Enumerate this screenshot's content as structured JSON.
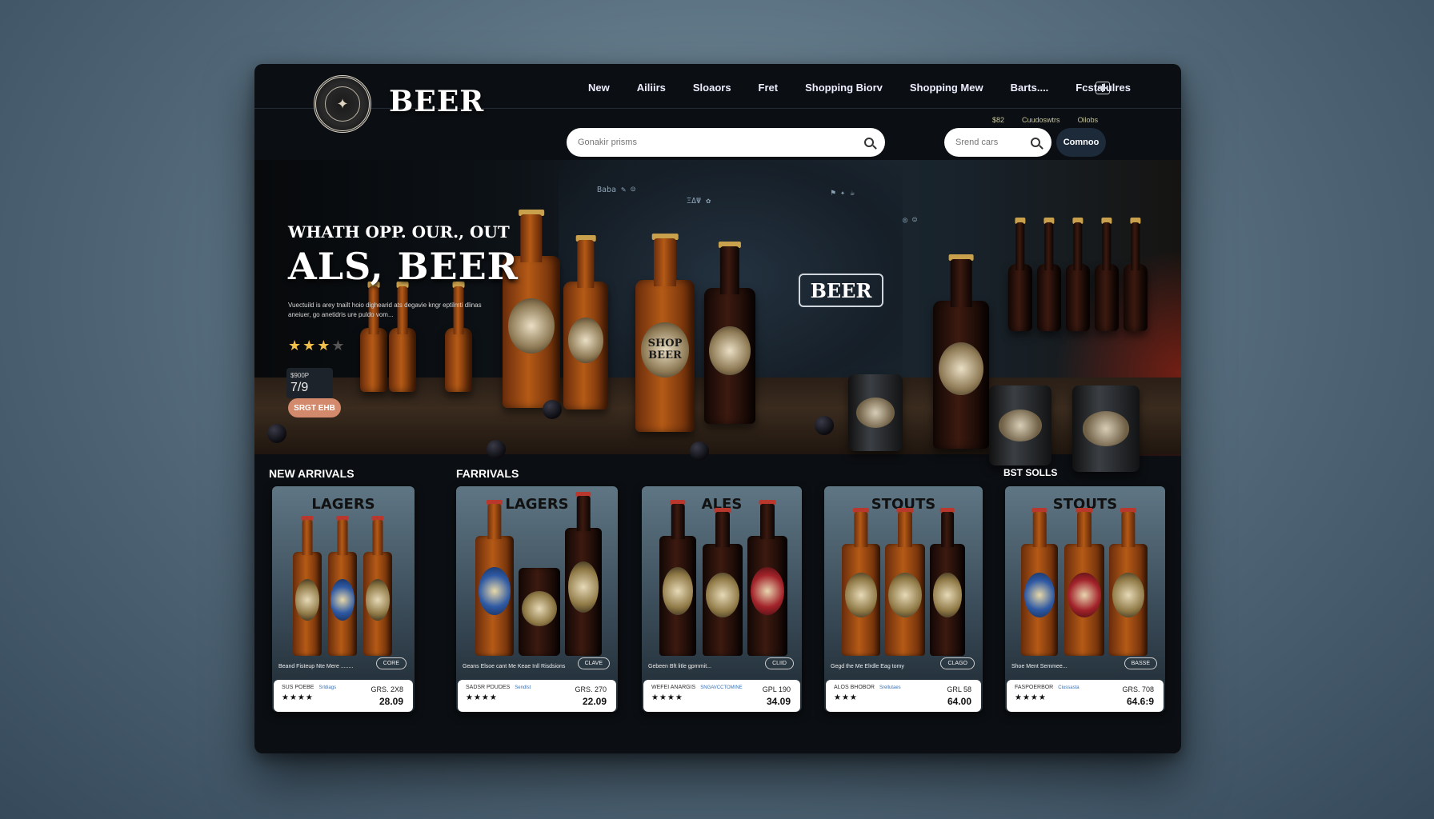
{
  "header": {
    "brand": "BEER",
    "nav": [
      "New",
      "Ailiirs",
      "Sloaors",
      "Fret",
      "Shopping Biorv",
      "Shopping Mew",
      "Barts....",
      "Fcstalulres"
    ],
    "utility": [
      "$82",
      "Cuudoswtrs",
      "Oilobs"
    ]
  },
  "search": {
    "main_placeholder": "Gonakir prisms",
    "small_placeholder": "Srend cars",
    "go_label": "Comnoo"
  },
  "hero": {
    "kicker": "WHATH OPP. OUR., OUT",
    "title": "ALS, BEER",
    "description": "Vuectuild is arey tnailt hoio dighearid ats degavie kngr eptilmti dlinas aneiuer, go anetidris ure puldo vom...",
    "rating": 3,
    "price_label": "$900P",
    "price_value": "7/9",
    "cta": "SRGT EHB",
    "board_sign": "BEER"
  },
  "sections": {
    "left": "NEW ARRIVALS",
    "mid": "FARRIVALS",
    "right": "BST SOLLS"
  },
  "cards": [
    {
      "title": "LAGERS",
      "desc": "Beand Fisteup Nte Mere ........",
      "tag": "CORE",
      "line1": "SUS POEBE",
      "sub": "Srldiags",
      "old": "GRS. 2X8",
      "price": "28.09",
      "stars": "★★★★"
    },
    {
      "title": "LAGERS",
      "desc": "Geans Elsoe cant Me Keae Inll Risdsions",
      "tag": "CLAVE",
      "line1": "SADSR PDUDES",
      "sub": "Sendlst",
      "old": "GRS. 270",
      "price": "22.09",
      "stars": "★★★★"
    },
    {
      "title": "ALES",
      "desc": "Gebeen Bft litle gprnmit...",
      "tag": "CLIID",
      "line1": "WEFEI ANARGIS",
      "sub": "SNGAVCCTOMINE",
      "old": "GPL 190",
      "price": "34.09",
      "stars": "★★★★"
    },
    {
      "title": "STOUTS",
      "desc": "Gegd the Me Elrdle Eag tomy",
      "tag": "CLAGO",
      "line1": "ALOS BHOBOR",
      "sub": "Srellutaes",
      "old": "GRL 58",
      "price": "64.00",
      "stars": "★★★"
    },
    {
      "title": "STOUTS",
      "desc": "Shoe Ment Semmee...",
      "tag": "BASSE",
      "line1": "FASPOERBOR",
      "sub": "Ciussasta",
      "old": "GRS. 708",
      "price": "64.6:9",
      "stars": "★★★★"
    }
  ]
}
